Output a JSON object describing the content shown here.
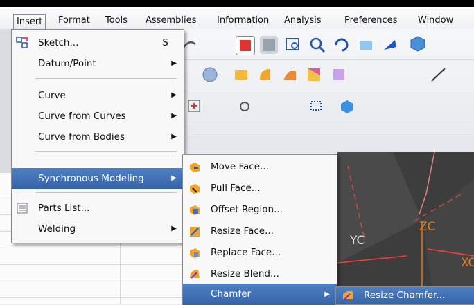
{
  "menubar": {
    "items": [
      {
        "label": "Insert",
        "accel": "s"
      },
      {
        "label": "Format",
        "accel": "m"
      },
      {
        "label": "Tools",
        "accel": "T"
      },
      {
        "label": "Assemblies",
        "accel": "A"
      },
      {
        "label": "Information",
        "accel": "I"
      },
      {
        "label": "Analysis",
        "accel": "l"
      },
      {
        "label": "Preferences",
        "accel": "P"
      },
      {
        "label": "Window",
        "accel": "d"
      }
    ]
  },
  "insert_menu": {
    "items": [
      {
        "label": "Sketch...",
        "accel": "S",
        "shortcut": "S",
        "icon": "sketch-icon",
        "submenu": false
      },
      {
        "label": "Datum/Point",
        "submenu": true
      },
      {
        "label": "Curve",
        "submenu": true
      },
      {
        "label": "Curve from Curves",
        "submenu": true
      },
      {
        "label": "Curve from Bodies",
        "submenu": true
      },
      {
        "label": "Synchronous Modeling",
        "submenu": true,
        "highlighted": true
      },
      {
        "label": "Parts List...",
        "icon": "parts-list-icon",
        "submenu": false
      },
      {
        "label": "Welding",
        "submenu": true
      }
    ]
  },
  "sync_menu": {
    "items": [
      {
        "label": "Move Face...",
        "icon": "move-face-icon"
      },
      {
        "label": "Pull Face...",
        "icon": "pull-face-icon"
      },
      {
        "label": "Offset Region...",
        "icon": "offset-region-icon"
      },
      {
        "label": "Resize Face...",
        "icon": "resize-face-icon"
      },
      {
        "label": "Replace Face...",
        "icon": "replace-face-icon"
      },
      {
        "label": "Resize Blend...",
        "icon": "resize-blend-icon"
      },
      {
        "label": "Chamfer",
        "submenu": true,
        "highlighted": true
      }
    ]
  },
  "chamfer_menu": {
    "items": [
      {
        "label": "Resize Chamfer...",
        "icon": "resize-chamfer-icon",
        "highlighted": true
      }
    ]
  },
  "viewport": {
    "axis_labels": [
      "YC",
      "ZC",
      "XC"
    ]
  },
  "colors": {
    "highlight": "#3f6fb5",
    "menu_bg": "#f8f8f8",
    "axis_orange": "#e07a1e"
  }
}
